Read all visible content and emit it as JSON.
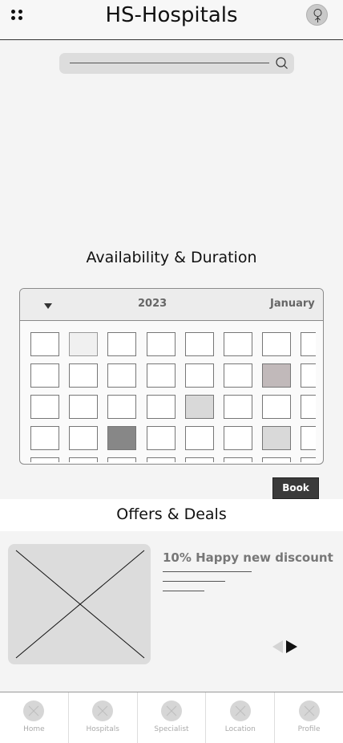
{
  "header": {
    "title": "HS-Hospitals",
    "menu_icon": "grid-dots-icon",
    "avatar_icon": "user-avatar-icon"
  },
  "search": {
    "value": "",
    "icon": "search-icon"
  },
  "availability": {
    "title": "Availability & Duration",
    "year": "2023",
    "month": "January",
    "dropdown_icon": "caret-down-icon"
  },
  "book": {
    "label": "Book"
  },
  "offers": {
    "title": "Offers & Deals",
    "items": [
      {
        "title": "10% Happy new discount",
        "image_icon": "image-placeholder-icon"
      }
    ],
    "prev_icon": "arrow-left-icon",
    "next_icon": "arrow-right-icon"
  },
  "nav": {
    "items": [
      {
        "label": "Home",
        "icon": "placeholder-icon"
      },
      {
        "label": "Hospitals",
        "icon": "placeholder-icon"
      },
      {
        "label": "Specialist",
        "icon": "placeholder-icon"
      },
      {
        "label": "Location",
        "icon": "placeholder-icon"
      },
      {
        "label": "Profile",
        "icon": "placeholder-icon"
      }
    ]
  },
  "colors": {
    "primary_dark": "#3a3a3a",
    "slot_light": "#f0f0f0",
    "slot_mauve": "#c1b9ba",
    "slot_grey": "#d9d9d9",
    "slot_dark": "#878787"
  }
}
